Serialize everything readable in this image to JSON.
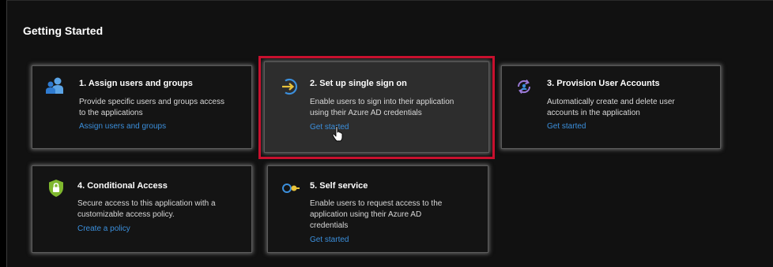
{
  "section": {
    "title": "Getting Started"
  },
  "cards": [
    {
      "title": "1. Assign users and groups",
      "desc_lines": [
        "Provide specific users and groups access",
        "to the applications"
      ],
      "link": "Assign users and groups",
      "icon": "users-icon"
    },
    {
      "title": "2. Set up single sign on",
      "desc_lines": [
        "Enable users to sign into their application",
        "using their Azure AD credentials"
      ],
      "link": "Get started",
      "icon": "sign-in-arrow-icon"
    },
    {
      "title": "3. Provision User Accounts",
      "desc_lines": [
        "Automatically create and delete user",
        "accounts in the application"
      ],
      "link": "Get started",
      "icon": "provisioning-icon"
    },
    {
      "title": "4. Conditional Access",
      "desc_lines": [
        "Secure access to this application with a",
        "customizable access policy."
      ],
      "link": "Create a policy",
      "icon": "shield-lock-icon"
    },
    {
      "title": "5. Self service",
      "desc_lines": [
        "Enable users to request access to the",
        "application using their Azure AD",
        "credentials"
      ],
      "link": "Get started",
      "icon": "self-service-icon"
    }
  ],
  "colors": {
    "link": "#3b8fdc",
    "highlight_border": "#c8102e",
    "background": "#111111",
    "card_background": "#141414",
    "highlighted_card_background": "#2d2d2d"
  }
}
